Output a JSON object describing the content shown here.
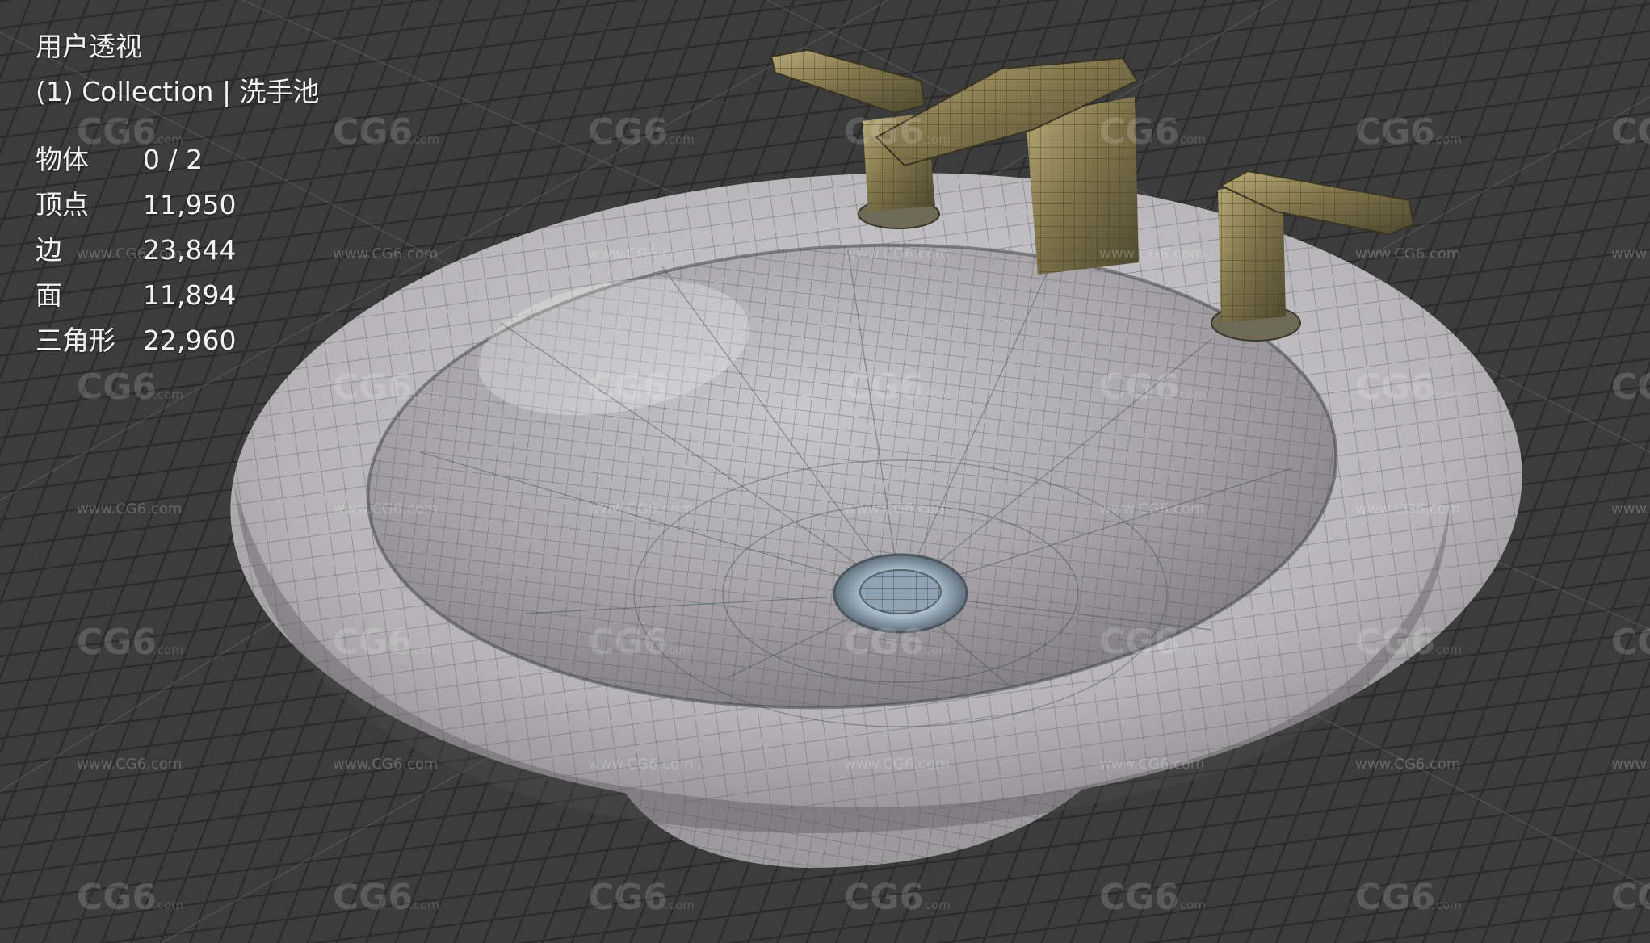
{
  "viewport": {
    "view_name": "用户透视",
    "collection_line": "(1) Collection | 洗手池"
  },
  "stats": [
    {
      "label": "物体",
      "value": "0 / 2"
    },
    {
      "label": "顶点",
      "value": "11,950"
    },
    {
      "label": "边",
      "value": "23,844"
    },
    {
      "label": "面",
      "value": "11,894"
    },
    {
      "label": "三角形",
      "value": "22,960"
    }
  ],
  "watermark": {
    "logo": "CG6",
    "logo_suffix": ".com",
    "url": "www.CG6.com"
  },
  "colors": {
    "background": "#3a3a3a",
    "grid_line": "#2a2a2a",
    "basin": "#b9b7b8",
    "faucet": "#8a7e55",
    "drain": "#9fb3c4",
    "text": "#f2f2f2"
  },
  "icons": [
    "sink-model",
    "faucet-model",
    "drain"
  ]
}
